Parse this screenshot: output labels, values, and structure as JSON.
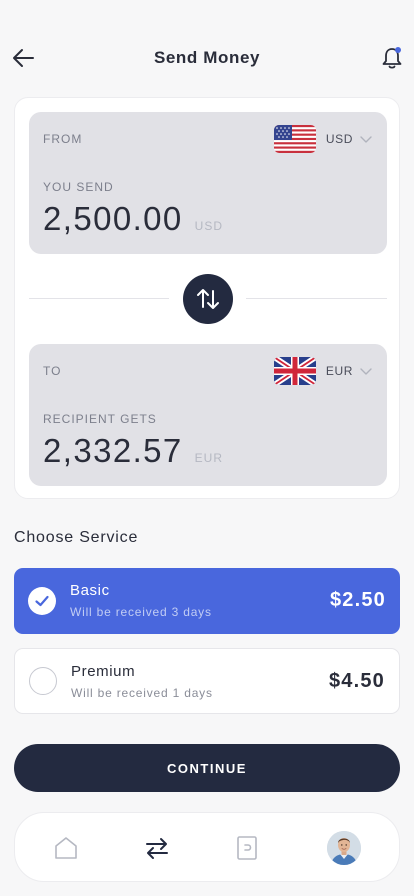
{
  "header": {
    "title": "Send Money",
    "back_icon": "arrow-left-icon",
    "notification_icon": "bell-icon",
    "notification_dot_color": "#4967dd"
  },
  "from": {
    "label": "FROM",
    "currency": "USD",
    "flag": "us-flag-icon",
    "amount_label": "YOU SEND",
    "amount": "2,500.00",
    "amount_unit": "USD"
  },
  "swap": {
    "icon": "swap-vertical-icon"
  },
  "to": {
    "label": "TO",
    "currency": "EUR",
    "flag": "uk-flag-icon",
    "amount_label": "RECIPIENT GETS",
    "amount": "2,332.57",
    "amount_unit": "EUR"
  },
  "services": {
    "title": "Choose Service",
    "items": [
      {
        "name": "Basic",
        "subtitle": "Will be received 3 days",
        "price": "$2.50",
        "selected": true
      },
      {
        "name": "Premium",
        "subtitle": "Will be received 1 days",
        "price": "$4.50",
        "selected": false
      }
    ]
  },
  "continue_label": "CONTINUE",
  "nav": {
    "items": [
      {
        "icon": "home-icon",
        "active": false
      },
      {
        "icon": "transfer-icon",
        "active": true
      },
      {
        "icon": "wallet-icon",
        "active": false
      },
      {
        "icon": "profile-avatar",
        "active": false
      }
    ]
  },
  "colors": {
    "accent": "#4967dd",
    "dark": "#232a40",
    "panel": "#e1e1e6",
    "background": "#f7f7f8"
  }
}
